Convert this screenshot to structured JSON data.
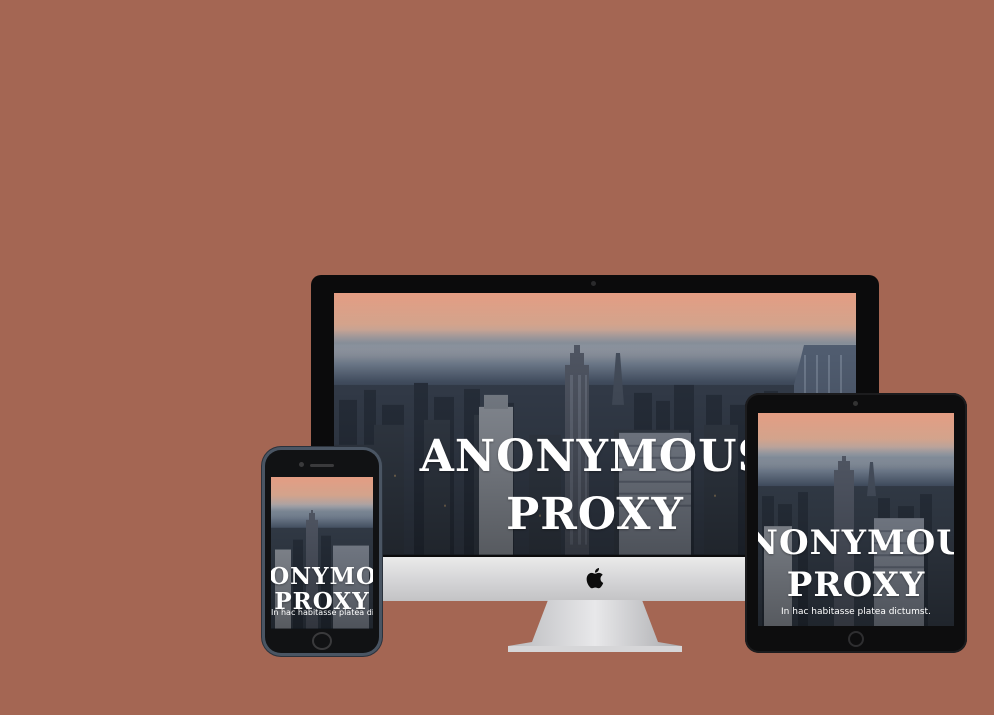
{
  "background_color": "#a46653",
  "devices": {
    "imac": {
      "headline_line1": "ANONYMOUS",
      "headline_line2": "PROXY",
      "logo_icon": "apple-logo-icon"
    },
    "ipad": {
      "headline_line1": "ANONYMOUS",
      "headline_line2": "PROXY",
      "subtitle": "In hac habitasse platea dictumst."
    },
    "iphone": {
      "headline_line1": "ANONYMOUS",
      "headline_line2": "PROXY",
      "subtitle": "In hac habitasse platea dictumst."
    }
  }
}
